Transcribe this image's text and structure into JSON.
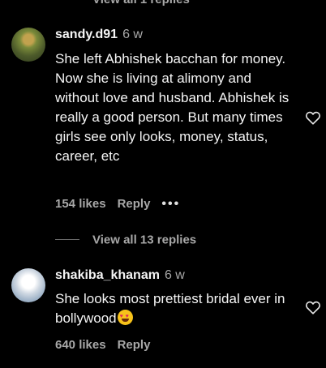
{
  "top_view_replies": "View all 1 replies",
  "comments": [
    {
      "username": "sandy.d91",
      "age": "6 w",
      "text": "She left Abhishek bacchan for money. Now she is living at alimony and without love and husband. Abhishek is really a good person. But many times girls see only looks, money, status, career, etc",
      "likes": "154 likes",
      "reply_label": "Reply",
      "more_label": "•••",
      "view_replies": "View all 13 replies"
    },
    {
      "username": "shakiba_khanam",
      "age": "6 w",
      "text": "She looks most prettiest bridal ever in bollywood",
      "emoji": "smiling-face-with-heart-eyes",
      "likes": "640 likes",
      "reply_label": "Reply"
    }
  ],
  "colors": {
    "background": "#000000",
    "text": "#f5f5f5",
    "secondary": "#a8a8a8"
  }
}
